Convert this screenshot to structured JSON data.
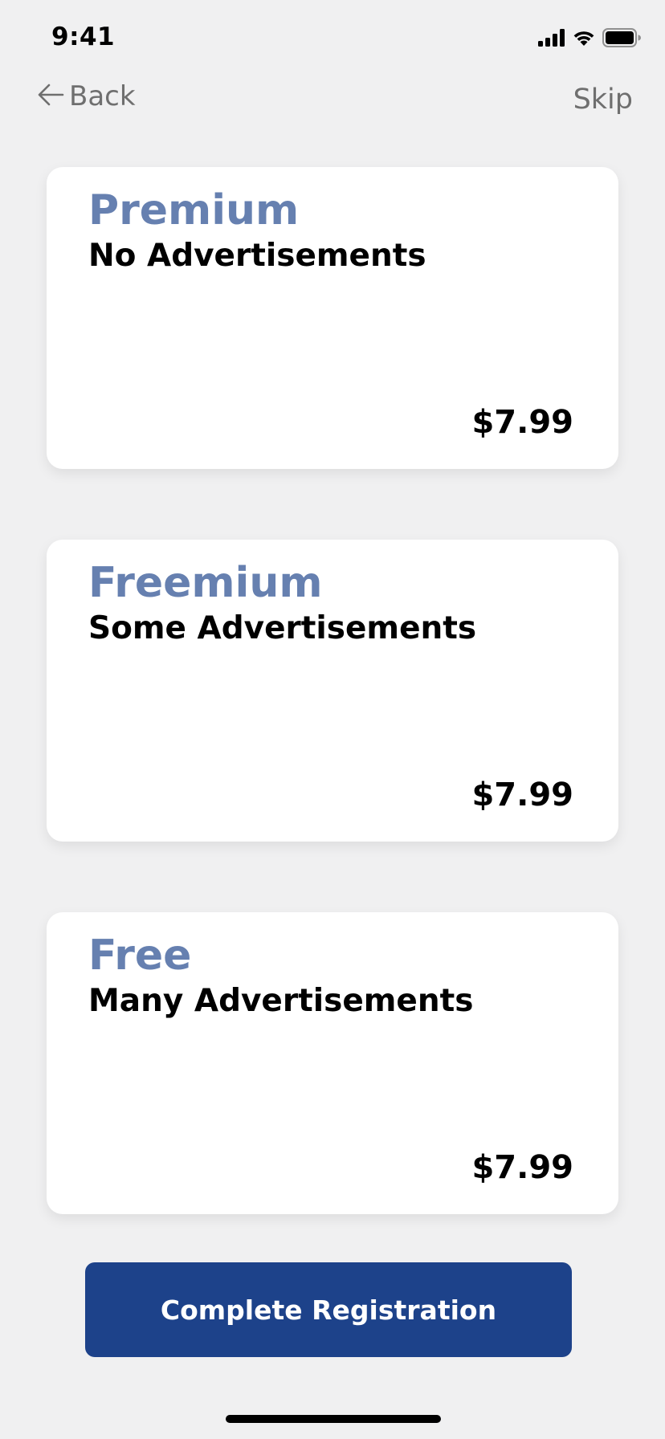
{
  "status_bar": {
    "time": "9:41"
  },
  "nav": {
    "back_label": "Back",
    "skip_label": "Skip"
  },
  "plans": [
    {
      "name": "Premium",
      "description": "No Advertisements",
      "price": "$7.99"
    },
    {
      "name": "Freemium",
      "description": "Some Advertisements",
      "price": "$7.99"
    },
    {
      "name": "Free",
      "description": "Many Advertisements",
      "price": "$7.99"
    }
  ],
  "actions": {
    "complete_label": "Complete Registration"
  },
  "colors": {
    "background": "#f0f0f1",
    "plan_title": "#6680b0",
    "primary_button": "#1d428a"
  },
  "icons": {
    "back": "arrow-left-icon",
    "cellular": "cellular-signal-icon",
    "wifi": "wifi-icon",
    "battery": "battery-icon"
  }
}
